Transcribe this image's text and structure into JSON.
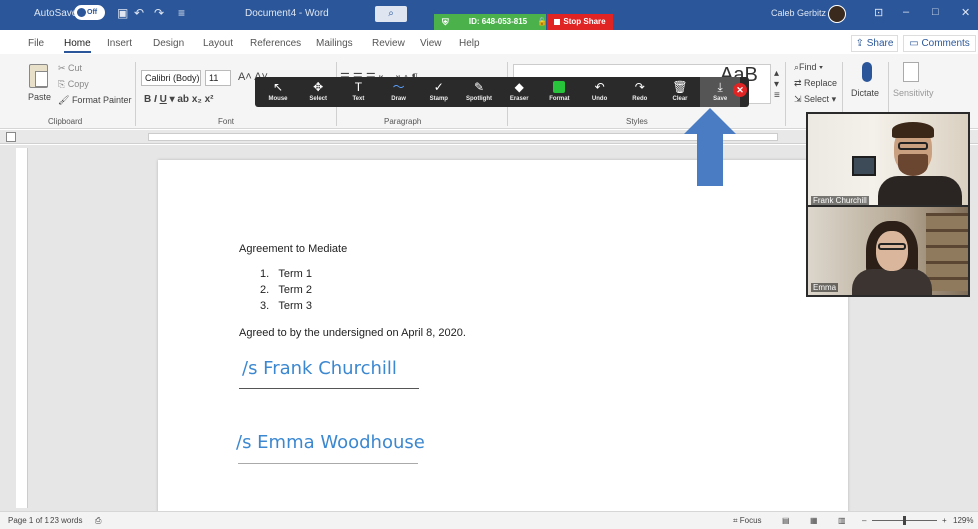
{
  "titlebar": {
    "autosave_label": "AutoSave",
    "autosave_state": "Off",
    "document_title": "Document4 - Word",
    "user_name": "Caleb Gerbitz",
    "search_icon": "search-icon"
  },
  "zoom": {
    "meeting_id": "ID: 648-053-815",
    "stop_share_label": "Stop Share",
    "banner_color": "#4bb24b",
    "stop_color": "#e02424"
  },
  "tabs": [
    "File",
    "Home",
    "Insert",
    "Design",
    "Layout",
    "References",
    "Mailings",
    "Review",
    "View",
    "Help"
  ],
  "active_tab": "Home",
  "share_label": "Share",
  "comments_label": "Comments",
  "ribbon": {
    "clipboard": {
      "paste": "Paste",
      "cut": "Cut",
      "copy": "Copy",
      "format_painter": "Format Painter",
      "group_label": "Clipboard"
    },
    "font": {
      "font_name": "Calibri (Body)",
      "font_size": "11",
      "group_label": "Font"
    },
    "paragraph": {
      "group_label": "Paragraph"
    },
    "styles": {
      "sample": "AaB",
      "group_label": "Styles"
    },
    "editing": {
      "find": "Find",
      "replace": "Replace",
      "select": "Select"
    },
    "voice": {
      "dictate": "Dictate"
    },
    "sensitivity": {
      "label": "Sensitivity"
    }
  },
  "annotation_tools": [
    {
      "label": "Mouse",
      "icon": "cursor-icon",
      "glyph": "↖"
    },
    {
      "label": "Select",
      "icon": "move-icon",
      "glyph": "✥"
    },
    {
      "label": "Text",
      "icon": "text-icon",
      "glyph": "T"
    },
    {
      "label": "Draw",
      "icon": "draw-icon",
      "glyph": "〜"
    },
    {
      "label": "Stamp",
      "icon": "stamp-icon",
      "glyph": "✓"
    },
    {
      "label": "Spotlight",
      "icon": "spotlight-icon",
      "glyph": "✎"
    },
    {
      "label": "Eraser",
      "icon": "eraser-icon",
      "glyph": "◆"
    },
    {
      "label": "Format",
      "icon": "format-icon",
      "glyph": ""
    },
    {
      "label": "Undo",
      "icon": "undo-icon",
      "glyph": "↶"
    },
    {
      "label": "Redo",
      "icon": "redo-icon",
      "glyph": "↷"
    },
    {
      "label": "Clear",
      "icon": "trash-icon",
      "glyph": "🗑"
    },
    {
      "label": "Save",
      "icon": "save-icon",
      "glyph": "⤓"
    }
  ],
  "document": {
    "heading": "Agreement to Mediate",
    "list": [
      "Term 1",
      "Term 2",
      "Term 3"
    ],
    "agreed_text": "Agreed to by the undersigned on April 8, 2020.",
    "signature_1": "/s Frank Churchill",
    "signature_2": "/s Emma Woodhouse",
    "signature_color": "#3c88d0"
  },
  "participants": [
    {
      "name": "Frank Churchill"
    },
    {
      "name": "Emma"
    }
  ],
  "status": {
    "page": "Page 1 of 1",
    "words": "23 words",
    "focus": "Focus",
    "zoom": "129%"
  }
}
